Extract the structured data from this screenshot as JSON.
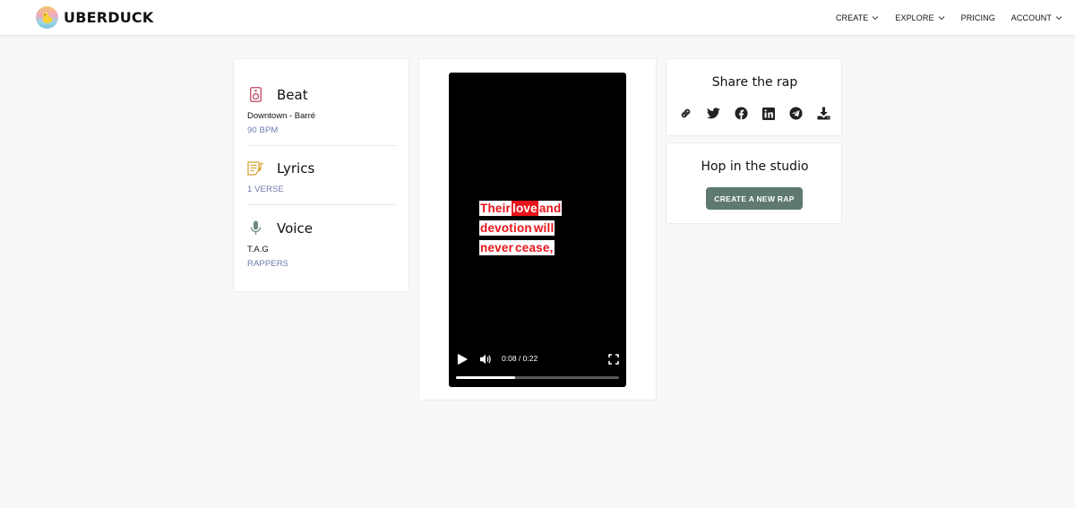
{
  "app": {
    "name": "UBERDUCK"
  },
  "nav": [
    {
      "label": "CREATE",
      "has_dropdown": true
    },
    {
      "label": "EXPLORE",
      "has_dropdown": true
    },
    {
      "label": "PRICING",
      "has_dropdown": false
    },
    {
      "label": "ACCOUNT",
      "has_dropdown": true
    }
  ],
  "info": {
    "beat": {
      "title": "Beat",
      "icon": "speaker-icon",
      "name": "Downtown - Barré",
      "meta": "90 BPM"
    },
    "lyrics": {
      "title": "Lyrics",
      "icon": "lyrics-icon",
      "meta": "1 VERSE"
    },
    "voice": {
      "title": "Voice",
      "icon": "microphone-icon",
      "name": "T.A.G",
      "meta": "RAPPERS"
    }
  },
  "video": {
    "caption_lines": [
      [
        "Their",
        "love",
        "and"
      ],
      [
        "devotion",
        "will"
      ],
      [
        "never",
        "cease,"
      ]
    ],
    "highlighted_word": "love",
    "time_display": "0:08 / 0:22",
    "progress": 0.36
  },
  "share": {
    "title": "Share the rap",
    "icons": [
      "link-icon",
      "twitter-icon",
      "facebook-icon",
      "linkedin-icon",
      "telegram-icon",
      "download-icon"
    ]
  },
  "studio": {
    "title": "Hop in the studio",
    "button_label": "CREATE A NEW RAP"
  },
  "colors": {
    "background": "#f8f8f6",
    "accent_button": "#5e7a6e",
    "caption_red": "#e8141b",
    "link_meta": "#6e7bb0",
    "beat_icon": "#c0475a",
    "lyrics_icon": "#d4a53a",
    "voice_icon": "#6f8a7d"
  }
}
